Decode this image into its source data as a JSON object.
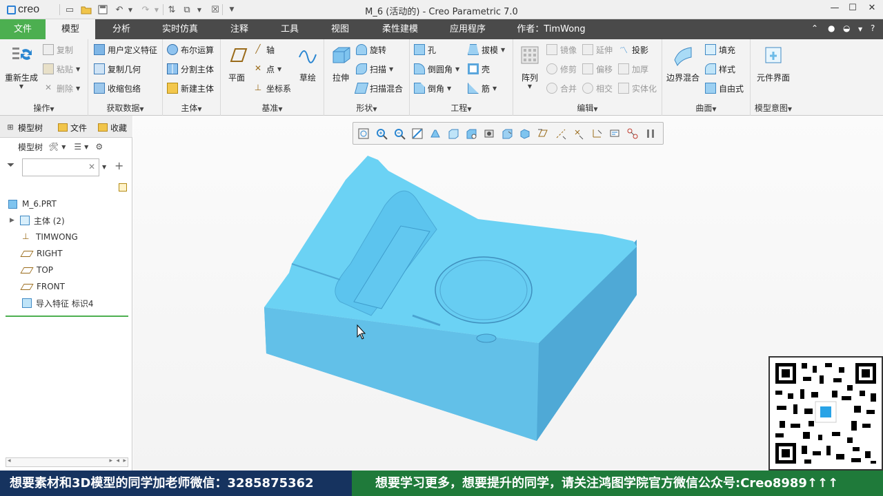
{
  "app": {
    "logo_text": "creo",
    "window_title": "M_6 (活动的) - Creo Parametric 7.0"
  },
  "tabs": [
    {
      "label": "文件"
    },
    {
      "label": "模型"
    },
    {
      "label": "分析"
    },
    {
      "label": "实时仿真"
    },
    {
      "label": "注释"
    },
    {
      "label": "工具"
    },
    {
      "label": "视图"
    },
    {
      "label": "柔性建模"
    },
    {
      "label": "应用程序"
    },
    {
      "label": "作者：TimWong"
    }
  ],
  "ribbon": {
    "operations": {
      "label": "操作",
      "regenerate": "重新生成",
      "copy": "复制",
      "paste": "粘贴",
      "delete": "删除"
    },
    "get_data": {
      "label": "获取数据",
      "udf": "用户定义特征",
      "copy_geom": "复制几何",
      "shrinkwrap": "收缩包络"
    },
    "body": {
      "label": "主体",
      "boolean": "布尔运算",
      "split_body": "分割主体",
      "new_body": "新建主体"
    },
    "datum": {
      "label": "基准",
      "plane": "平面",
      "axis": "轴",
      "point": "点",
      "csys": "坐标系",
      "sketch": "草绘"
    },
    "shapes": {
      "label": "形状",
      "extrude": "拉伸",
      "revolve": "旋转",
      "sweep": "扫描",
      "swept_blend": "扫描混合"
    },
    "engineering": {
      "label": "工程",
      "hole": "孔",
      "round": "倒圆角",
      "chamfer": "倒角",
      "draft": "拔模",
      "shell": "壳",
      "rib": "筋"
    },
    "editing": {
      "label": "编辑",
      "pattern": "阵列",
      "mirror": "镜像",
      "trim": "修剪",
      "merge": "合并",
      "extend": "延伸",
      "offset": "偏移",
      "intersect": "相交",
      "project": "投影",
      "thicken": "加厚",
      "solidify": "实体化"
    },
    "surfaces": {
      "label": "曲面",
      "boundary_blend": "边界混合",
      "fill": "填充",
      "style": "样式",
      "freestyle": "自由式"
    },
    "model_intent": {
      "label": "模型意图",
      "component_interface": "元件界面"
    }
  },
  "left_panel": {
    "tabs": [
      "模型树",
      "文件",
      "收藏"
    ],
    "header_label": "模型树",
    "filter_placeholder": "",
    "tree": [
      {
        "label": "M_6.PRT",
        "icon": "part-icon"
      },
      {
        "label": "主体 (2)",
        "icon": "body-icon"
      },
      {
        "label": "TIMWONG",
        "icon": "csys-icon"
      },
      {
        "label": "RIGHT",
        "icon": "datum-plane-icon"
      },
      {
        "label": "TOP",
        "icon": "datum-plane-icon"
      },
      {
        "label": "FRONT",
        "icon": "datum-plane-icon"
      },
      {
        "label": "导入特征 标识4",
        "icon": "import-feature-icon"
      }
    ]
  },
  "banner": {
    "left": "想要素材和3D模型的同学加老师微信：3285875362",
    "right": "想要学习更多，想要提升的同学，请关注鸿图学院官方微信公众号:Creo8989↑↑↑"
  },
  "colors": {
    "ribbon_tab_bar": "#4a4a4a",
    "file_tab": "#4caf50",
    "model_face": "#6ad0f3",
    "model_side": "#57b7e0",
    "banner_left": "#16335f",
    "banner_right": "#1f7a3a"
  }
}
